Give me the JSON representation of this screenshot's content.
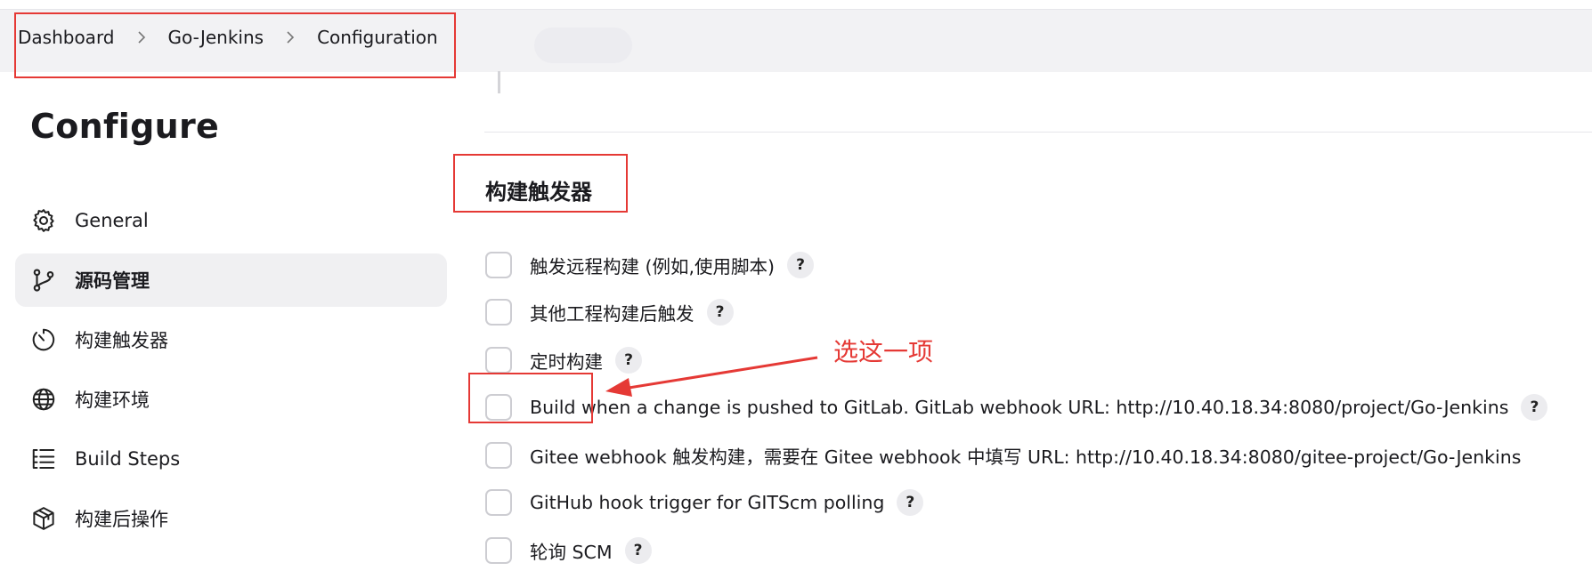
{
  "breadcrumb": {
    "items": [
      "Dashboard",
      "Go-Jenkins",
      "Configuration"
    ]
  },
  "page_title": "Configure",
  "sidebar": {
    "items": [
      {
        "label": "General",
        "icon": "gear-icon",
        "active": false
      },
      {
        "label": "源码管理",
        "icon": "git-branch-icon",
        "active": true
      },
      {
        "label": "构建触发器",
        "icon": "timer-icon",
        "active": false
      },
      {
        "label": "构建环境",
        "icon": "globe-icon",
        "active": false
      },
      {
        "label": "Build Steps",
        "icon": "list-steps-icon",
        "active": false
      },
      {
        "label": "构建后操作",
        "icon": "package-icon",
        "active": false
      }
    ]
  },
  "section": {
    "title": "构建触发器",
    "options": [
      {
        "label": "触发远程构建 (例如,使用脚本)",
        "checked": false,
        "help": "?"
      },
      {
        "label": "其他工程构建后触发",
        "checked": false,
        "help": "?"
      },
      {
        "label": "定时构建",
        "checked": false,
        "help": "?"
      },
      {
        "label": "Build when a change is pushed to GitLab. GitLab webhook URL: http://10.40.18.34:8080/project/Go-Jenkins",
        "checked": false,
        "help": "?"
      },
      {
        "label": "Gitee webhook 触发构建，需要在 Gitee webhook 中填写 URL: http://10.40.18.34:8080/gitee-project/Go-Jenkins",
        "checked": false,
        "help": null
      },
      {
        "label": "GitHub hook trigger for GITScm polling",
        "checked": false,
        "help": "?"
      },
      {
        "label": "轮询 SCM",
        "checked": false,
        "help": "?"
      }
    ]
  },
  "annotation": {
    "text": "选这一项",
    "color": "#e53935"
  }
}
